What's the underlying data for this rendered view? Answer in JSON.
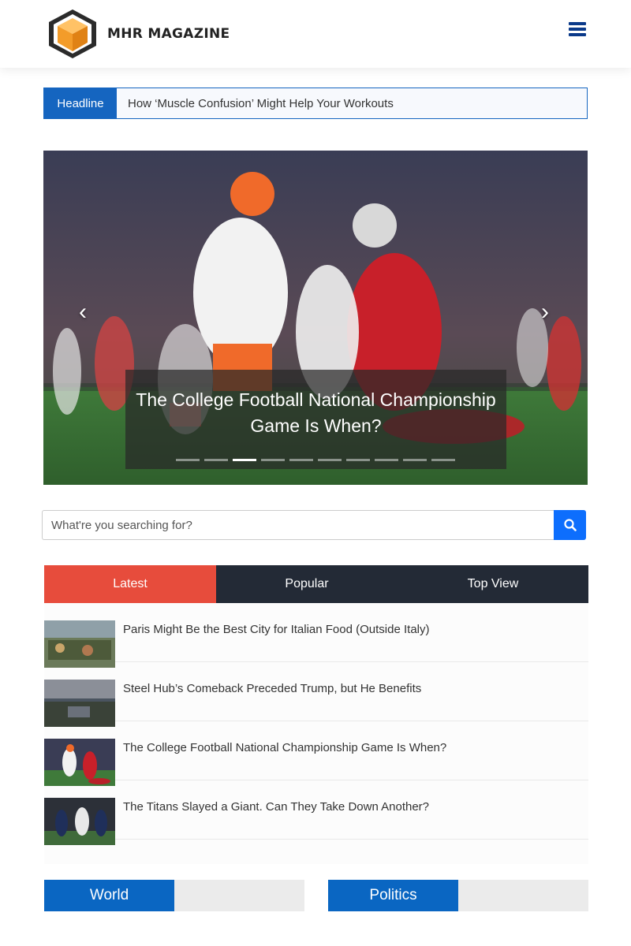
{
  "brand": {
    "name": "MHR MAGAZINE",
    "colors": {
      "primary": "#1565c0",
      "accent": "#e74c3c",
      "dark": "#232a36",
      "logo_orange": "#f39c2a"
    }
  },
  "header": {
    "menu_icon": "hamburger-menu-icon"
  },
  "ticker": {
    "label": "Headline",
    "text": "How ‘Muscle Confusion’ Might Help Your Workouts"
  },
  "carousel": {
    "caption": "The College Football National Championship Game Is When?",
    "slide_count": 10,
    "active_index": 2,
    "prev_icon": "chevron-left-icon",
    "next_icon": "chevron-right-icon"
  },
  "search": {
    "placeholder": "What're you searching for?",
    "value": "",
    "icon": "search-icon"
  },
  "tabs": [
    {
      "label": "Latest",
      "active": true
    },
    {
      "label": "Popular",
      "active": false
    },
    {
      "label": "Top View",
      "active": false
    }
  ],
  "news": [
    {
      "title": "Paris Might Be the Best City for Italian Food (Outside Italy)"
    },
    {
      "title": "Steel Hub’s Comeback Preceded Trump, but He Benefits"
    },
    {
      "title": "The College Football National Championship Game Is When?"
    },
    {
      "title": "The Titans Slayed a Giant. Can They Take Down Another?"
    }
  ],
  "sections": [
    {
      "label": "World"
    },
    {
      "label": "Politics"
    }
  ]
}
